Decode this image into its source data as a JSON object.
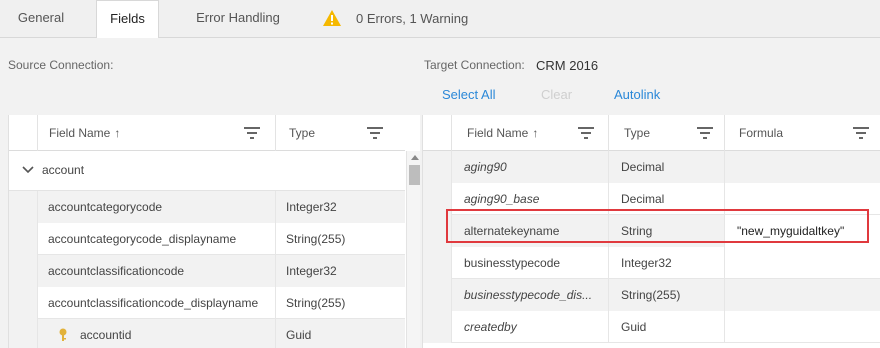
{
  "tabs": [
    {
      "label": "General"
    },
    {
      "label": "Fields"
    },
    {
      "label": "Error Handling"
    }
  ],
  "status": {
    "text": "0 Errors, 1 Warning",
    "icon": "warning-icon",
    "icon_color": "#f5b800"
  },
  "source": {
    "label": "Source Connection:",
    "columns": {
      "field": "Field Name",
      "type": "Type"
    },
    "group": "account",
    "rows": [
      {
        "field": "accountcategorycode",
        "type": "Integer32"
      },
      {
        "field": "accountcategorycode_displayname",
        "type": "String(255)"
      },
      {
        "field": "accountclassificationcode",
        "type": "Integer32"
      },
      {
        "field": "accountclassificationcode_displayname",
        "type": "String(255)"
      },
      {
        "field": "accountid",
        "type": "Guid"
      }
    ]
  },
  "target": {
    "label": "Target Connection:",
    "value": "CRM 2016",
    "actions": {
      "select_all": "Select All",
      "clear": "Clear",
      "autolink": "Autolink"
    },
    "columns": {
      "field": "Field Name",
      "type": "Type",
      "formula": "Formula"
    },
    "rows": [
      {
        "field": "aging90",
        "type": "Decimal",
        "formula": ""
      },
      {
        "field": "aging90_base",
        "type": "Decimal",
        "formula": ""
      },
      {
        "field": "alternatekeyname",
        "type": "String",
        "formula": "\"new_myguidaltkey\""
      },
      {
        "field": "businesstypecode",
        "type": "Integer32",
        "formula": ""
      },
      {
        "field": "businesstypecode_dis...",
        "type": "String(255)",
        "formula": ""
      },
      {
        "field": "createdby",
        "type": "Guid",
        "formula": ""
      }
    ]
  },
  "colors": {
    "accent": "#2b88d8",
    "highlight": "#e0393e"
  }
}
